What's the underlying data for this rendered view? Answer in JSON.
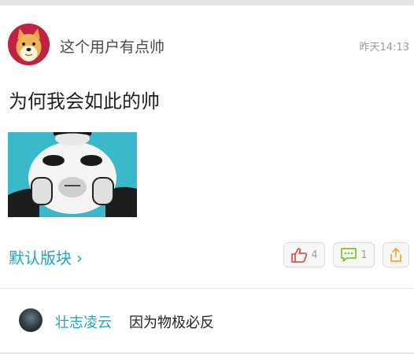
{
  "post": {
    "username": "这个用户有点帅",
    "timestamp": "昨天14:13",
    "text": "为何我会如此的帅",
    "category": "默认版块",
    "category_chevron": "›",
    "like_count": "4",
    "comment_count": "1",
    "icons": {
      "like": "thumbs-up-icon",
      "comment": "comment-bubble-icon",
      "share": "share-icon"
    }
  },
  "comment": {
    "author": "壮志凌云",
    "text": "因为物极必反"
  },
  "colors": {
    "accent": "#1aa7c4",
    "like": "#e0403a",
    "comment": "#7cc42b",
    "share": "#f5a623"
  }
}
